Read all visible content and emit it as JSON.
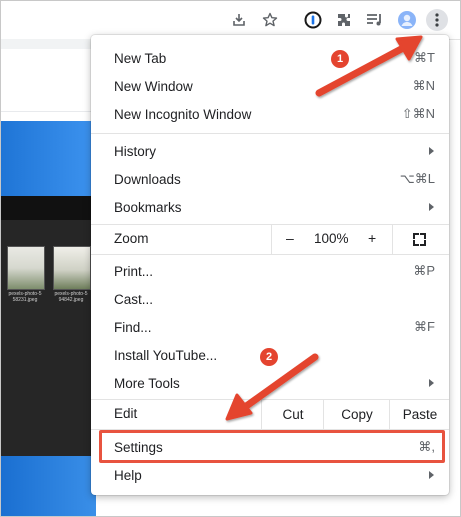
{
  "toolbar": {
    "icons": [
      "download-icon",
      "star-icon",
      "password-manager-icon",
      "extensions-icon",
      "reading-list-icon",
      "profile-icon",
      "menu-icon"
    ]
  },
  "background": {
    "thumb1_caption": "pexels-photo-5\n58231.jpeg",
    "thumb2_caption": "pexels-photo-5\n94842.jpeg"
  },
  "menu": {
    "new_tab": {
      "label": "New Tab",
      "shortcut": "⌘T"
    },
    "new_window": {
      "label": "New Window",
      "shortcut": "⌘N"
    },
    "new_incognito": {
      "label": "New Incognito Window",
      "shortcut": "⇧⌘N"
    },
    "history": {
      "label": "History"
    },
    "downloads": {
      "label": "Downloads",
      "shortcut": "⌥⌘L"
    },
    "bookmarks": {
      "label": "Bookmarks"
    },
    "zoom": {
      "label": "Zoom",
      "minus": "–",
      "value": "100%",
      "plus": "+"
    },
    "print": {
      "label": "Print...",
      "shortcut": "⌘P"
    },
    "cast": {
      "label": "Cast..."
    },
    "find": {
      "label": "Find...",
      "shortcut": "⌘F"
    },
    "install": {
      "label": "Install YouTube..."
    },
    "more_tools": {
      "label": "More Tools"
    },
    "edit": {
      "label": "Edit",
      "cut": "Cut",
      "copy": "Copy",
      "paste": "Paste"
    },
    "settings": {
      "label": "Settings",
      "shortcut": "⌘,"
    },
    "help": {
      "label": "Help"
    }
  },
  "annotations": {
    "step1": "1",
    "step2": "2",
    "color": "#e4442f"
  }
}
